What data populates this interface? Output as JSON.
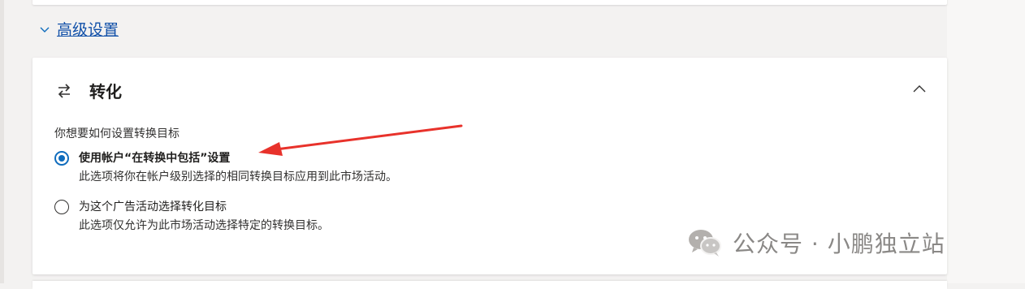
{
  "advanced": {
    "label": "高级设置",
    "expanded": true
  },
  "conversion": {
    "title": "转化",
    "question": "你想要如何设置转换目标",
    "options": [
      {
        "label": "使用帐户“在转换中包括”设置",
        "description": "此选项将你在帐户级别选择的相同转换目标应用到此市场活动。",
        "selected": true
      },
      {
        "label": "为这个广告活动选择转化目标",
        "description": "此选项仅允许为此市场活动选择特定的转换目标。",
        "selected": false
      }
    ]
  },
  "watermark": {
    "text": "公众号 · 小鹏独立站"
  },
  "colors": {
    "accent": "#0f6cbd",
    "link": "#0f4fa8",
    "annotation_arrow": "#e8322b"
  },
  "icons": {
    "advanced_chevron": "chevron-down-icon",
    "section": "swap-arrows-icon",
    "collapse": "chevron-up-icon"
  }
}
